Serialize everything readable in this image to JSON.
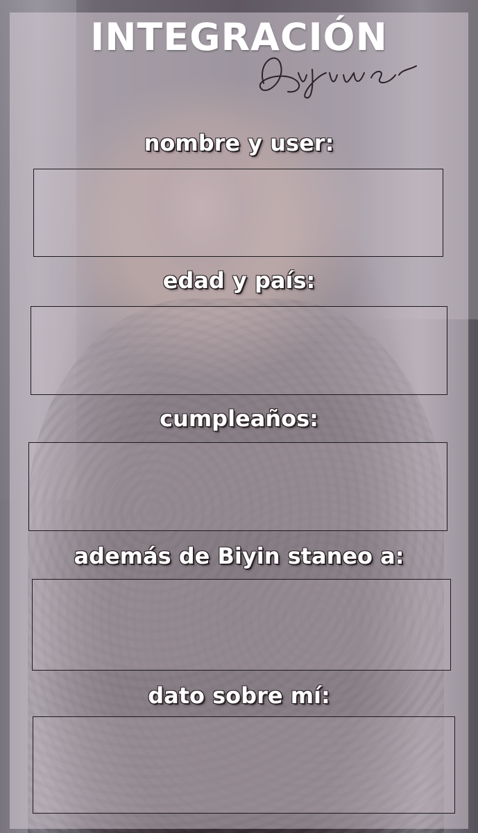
{
  "title": "INTEGRACIÓN",
  "signature": "Biyiner",
  "fields": [
    {
      "label": "nombre y user:"
    },
    {
      "label": "edad y país:"
    },
    {
      "label": "cumpleaños:"
    },
    {
      "label": "además de Biyin staneo a:"
    },
    {
      "label": "dato sobre mí:"
    }
  ]
}
